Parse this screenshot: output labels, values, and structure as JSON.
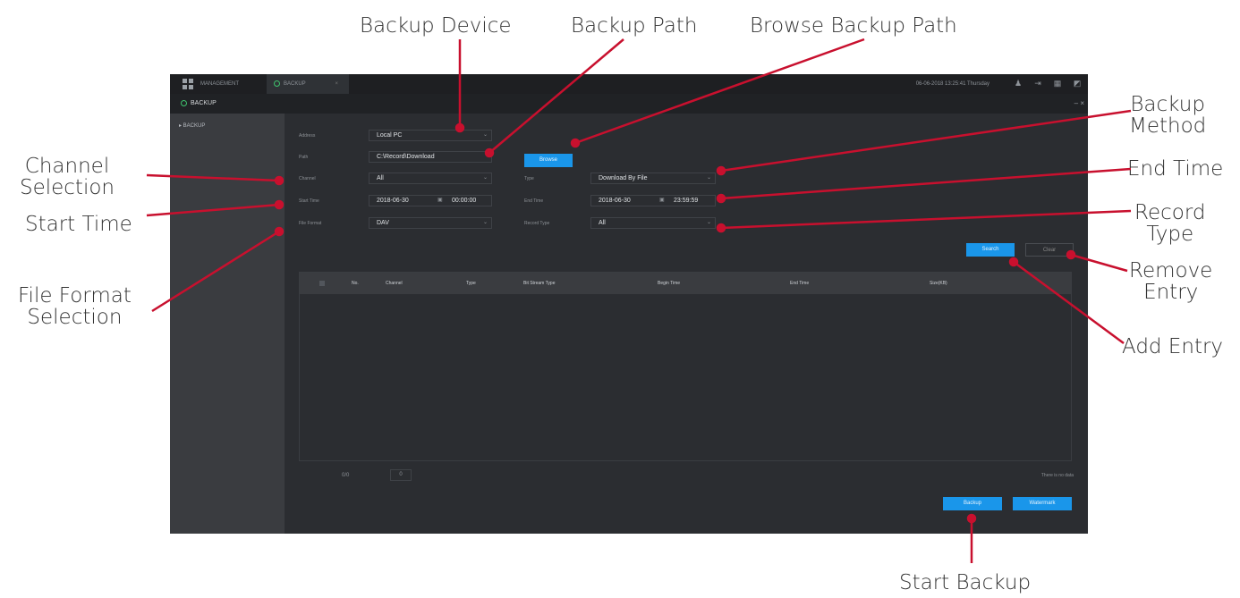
{
  "callouts": {
    "backup_device": "Backup Device",
    "backup_path": "Backup Path",
    "browse_backup_path": "Browse Backup Path",
    "backup_method": "Backup\nMethod",
    "channel_selection": "Channel\nSelection",
    "end_time": "End Time",
    "start_time": "Start Time",
    "record_type": "Record\nType",
    "remove_entry": "Remove\nEntry",
    "file_format_selection": "File Format\nSelection",
    "add_entry": "Add Entry",
    "start_backup": "Start Backup"
  },
  "topbar": {
    "management": "MANAGEMENT",
    "tab": "BACKUP",
    "datetime": "06-06-2018 13:25:41 Thursday"
  },
  "window": {
    "title": "BACKUP",
    "controls": "– ×"
  },
  "sidebar": {
    "items": [
      {
        "label": "▸ BACKUP"
      }
    ]
  },
  "form": {
    "address_label": "Address",
    "address_value": "Local PC",
    "path_label": "Path",
    "path_value": "C:\\Record\\Download",
    "browse": "Browse",
    "channel_label": "Channel",
    "channel_value": "All",
    "type_label": "Type",
    "type_value": "Download By File",
    "start_time_label": "Start Time",
    "start_date": "2018-06-30",
    "start_time": "00:00:00",
    "end_time_label": "End Time",
    "end_date": "2018-06-30",
    "end_time": "23:59:59",
    "file_format_label": "File Format",
    "file_format_value": "DAV",
    "record_type_label": "Record Type",
    "record_type_value": "All",
    "search": "Search",
    "clear": "Clear"
  },
  "table": {
    "columns": [
      "No.",
      "Channel",
      "Type",
      "Bit Stream Type",
      "Begin Time",
      "End Time",
      "Size(KB)"
    ]
  },
  "footer": {
    "pager": "0/0",
    "page_input": "0",
    "no_data": "There is no data",
    "backup": "Backup",
    "watermark": "Watermark"
  }
}
